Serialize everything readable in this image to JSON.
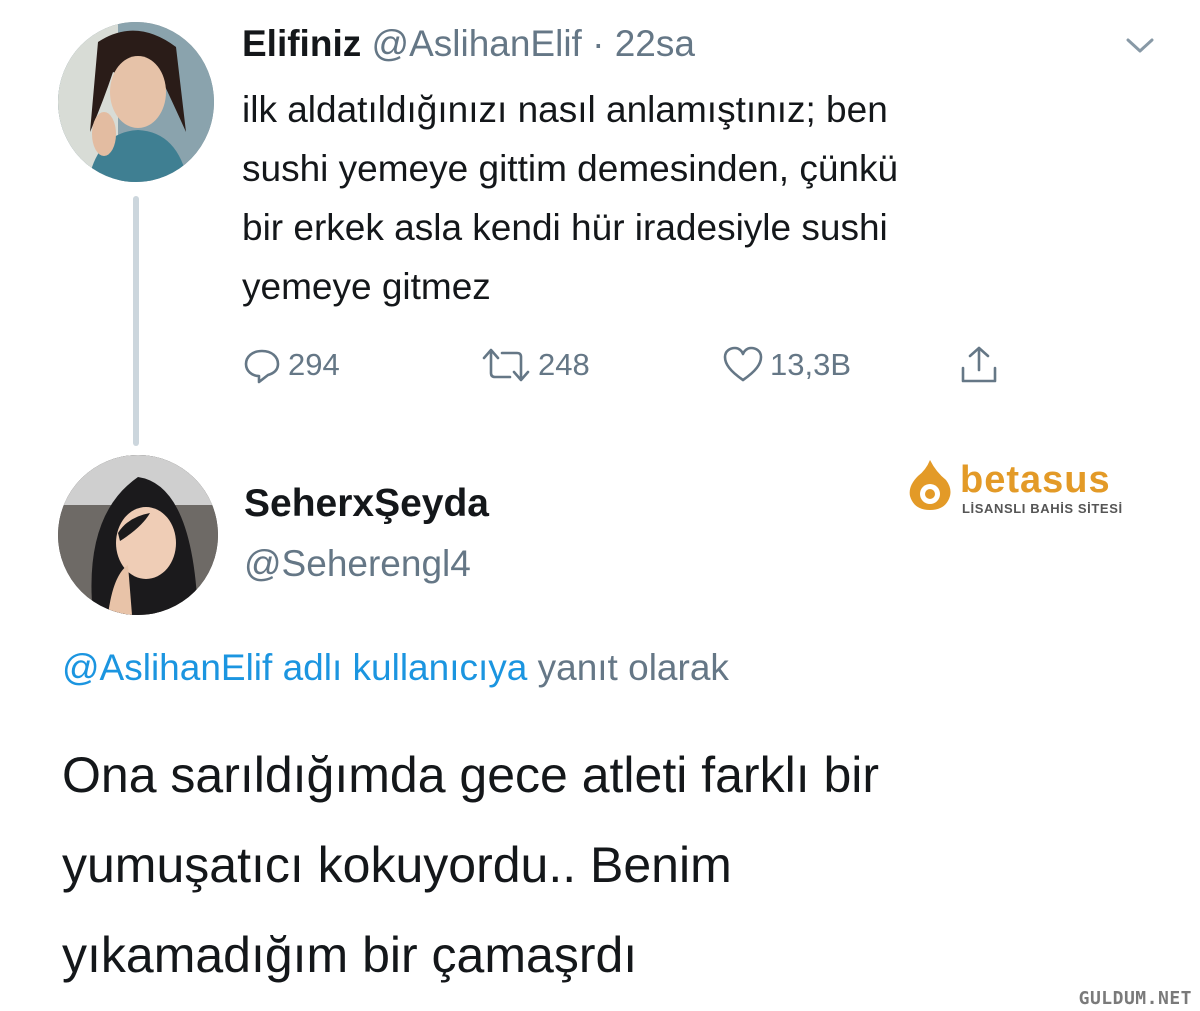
{
  "tweet1": {
    "display_name": "Elifiniz",
    "handle": "@AslihanElif",
    "separator": "·",
    "time": "22sa",
    "text": "ilk aldatıldığınızı nasıl anlamıştınız; ben\nsushi yemeye gittim demesinden, çünkü\nbir erkek asla kendi hür iradesiyle sushi\nyemeye gitmez",
    "actions": {
      "replies": "294",
      "retweets": "248",
      "likes": "13,3B"
    },
    "icons": [
      "reply-icon",
      "retweet-icon",
      "like-icon",
      "share-icon",
      "chevron-down-icon"
    ]
  },
  "tweet2": {
    "display_name": "SeherxŞeyda",
    "handle": "@Seherengl4",
    "reply_to_link": "@AslihanElif adlı kullanıcıya",
    "reply_to_suffix": "yanıt olarak",
    "text": "Ona sarıldığımda gece atleti farklı bir\nyumuşatıcı kokuyordu.. Benim\nyıkamadığım bir çamaşrdı"
  },
  "watermark": {
    "brand": "betasus",
    "tagline": "LİSANSLI BAHİS SİTESİ",
    "site": "GULDUM.NET"
  },
  "colors": {
    "text": "#14171a",
    "muted": "#657786",
    "link": "#1b95e0",
    "thread_line": "#ccd6dd",
    "brand": "#e39a27"
  }
}
